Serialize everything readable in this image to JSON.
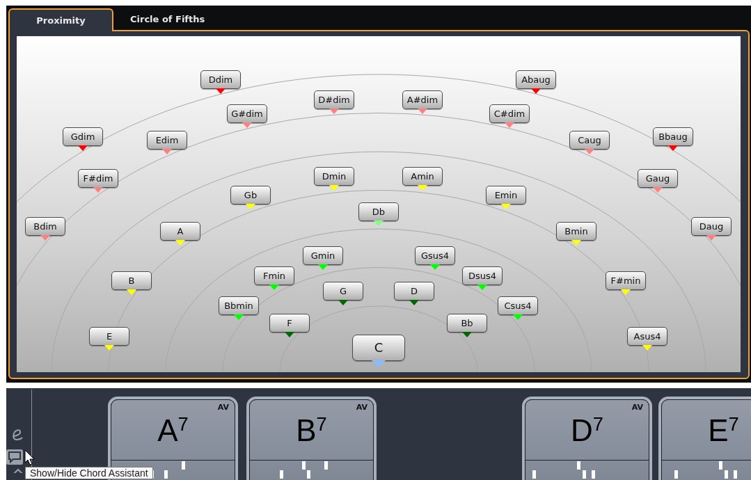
{
  "tabs": [
    {
      "label": "Proximity",
      "selected": true
    },
    {
      "label": "Circle of Fifths",
      "selected": false
    }
  ],
  "chords": [
    {
      "label": "Ddim",
      "color": "#ff0000",
      "selected": false
    },
    {
      "label": "Abaug",
      "color": "#ff0000",
      "selected": false
    },
    {
      "label": "D#dim",
      "color": "#ff8080",
      "selected": false
    },
    {
      "label": "A#dim",
      "color": "#ff8080",
      "selected": false
    },
    {
      "label": "G#dim",
      "color": "#ff8080",
      "selected": false
    },
    {
      "label": "C#dim",
      "color": "#ff8080",
      "selected": false
    },
    {
      "label": "Gdim",
      "color": "#ff0000",
      "selected": false
    },
    {
      "label": "Edim",
      "color": "#ff8080",
      "selected": false
    },
    {
      "label": "Caug",
      "color": "#ff8080",
      "selected": false
    },
    {
      "label": "Bbaug",
      "color": "#ff0000",
      "selected": false
    },
    {
      "label": "F#dim",
      "color": "#ff8080",
      "selected": false
    },
    {
      "label": "Dmin",
      "color": "#ffff00",
      "selected": false
    },
    {
      "label": "Amin",
      "color": "#ffff00",
      "selected": false
    },
    {
      "label": "Gaug",
      "color": "#ff8080",
      "selected": false
    },
    {
      "label": "Gb",
      "color": "#ffff00",
      "selected": false
    },
    {
      "label": "Emin",
      "color": "#ffff00",
      "selected": false
    },
    {
      "label": "Db",
      "color": "#80ff80",
      "selected": false
    },
    {
      "label": "Bdim",
      "color": "#ff8080",
      "selected": false
    },
    {
      "label": "A",
      "color": "#ffff00",
      "selected": false
    },
    {
      "label": "Bmin",
      "color": "#ffff00",
      "selected": false
    },
    {
      "label": "Daug",
      "color": "#ff8080",
      "selected": false
    },
    {
      "label": "Gmin",
      "color": "#00ff00",
      "selected": false
    },
    {
      "label": "Gsus4",
      "color": "#00ff00",
      "selected": false
    },
    {
      "label": "Fmin",
      "color": "#00ff00",
      "selected": false
    },
    {
      "label": "Dsus4",
      "color": "#00ff00",
      "selected": false
    },
    {
      "label": "B",
      "color": "#ffff00",
      "selected": false
    },
    {
      "label": "F#min",
      "color": "#ffff00",
      "selected": false
    },
    {
      "label": "G",
      "color": "#006600",
      "selected": false
    },
    {
      "label": "D",
      "color": "#006600",
      "selected": false
    },
    {
      "label": "Bbmin",
      "color": "#00ff00",
      "selected": false
    },
    {
      "label": "Csus4",
      "color": "#00ff00",
      "selected": false
    },
    {
      "label": "F",
      "color": "#006600",
      "selected": false
    },
    {
      "label": "Bb",
      "color": "#006600",
      "selected": false
    },
    {
      "label": "E",
      "color": "#ffff00",
      "selected": false
    },
    {
      "label": "Asus4",
      "color": "#ffff00",
      "selected": false
    },
    {
      "label": "C",
      "color": "#88bbff",
      "selected": true
    }
  ],
  "track": {
    "cards": [
      {
        "name": "A$^{7}$",
        "badge": "AV"
      },
      {
        "name": "B$^{7}$",
        "badge": "AV"
      },
      {
        "name": "D$^{7}$",
        "badge": "AV"
      },
      {
        "name": "E$^{7}$"
      }
    ]
  },
  "tooltip": "Show/Hide Chord Assistant"
}
